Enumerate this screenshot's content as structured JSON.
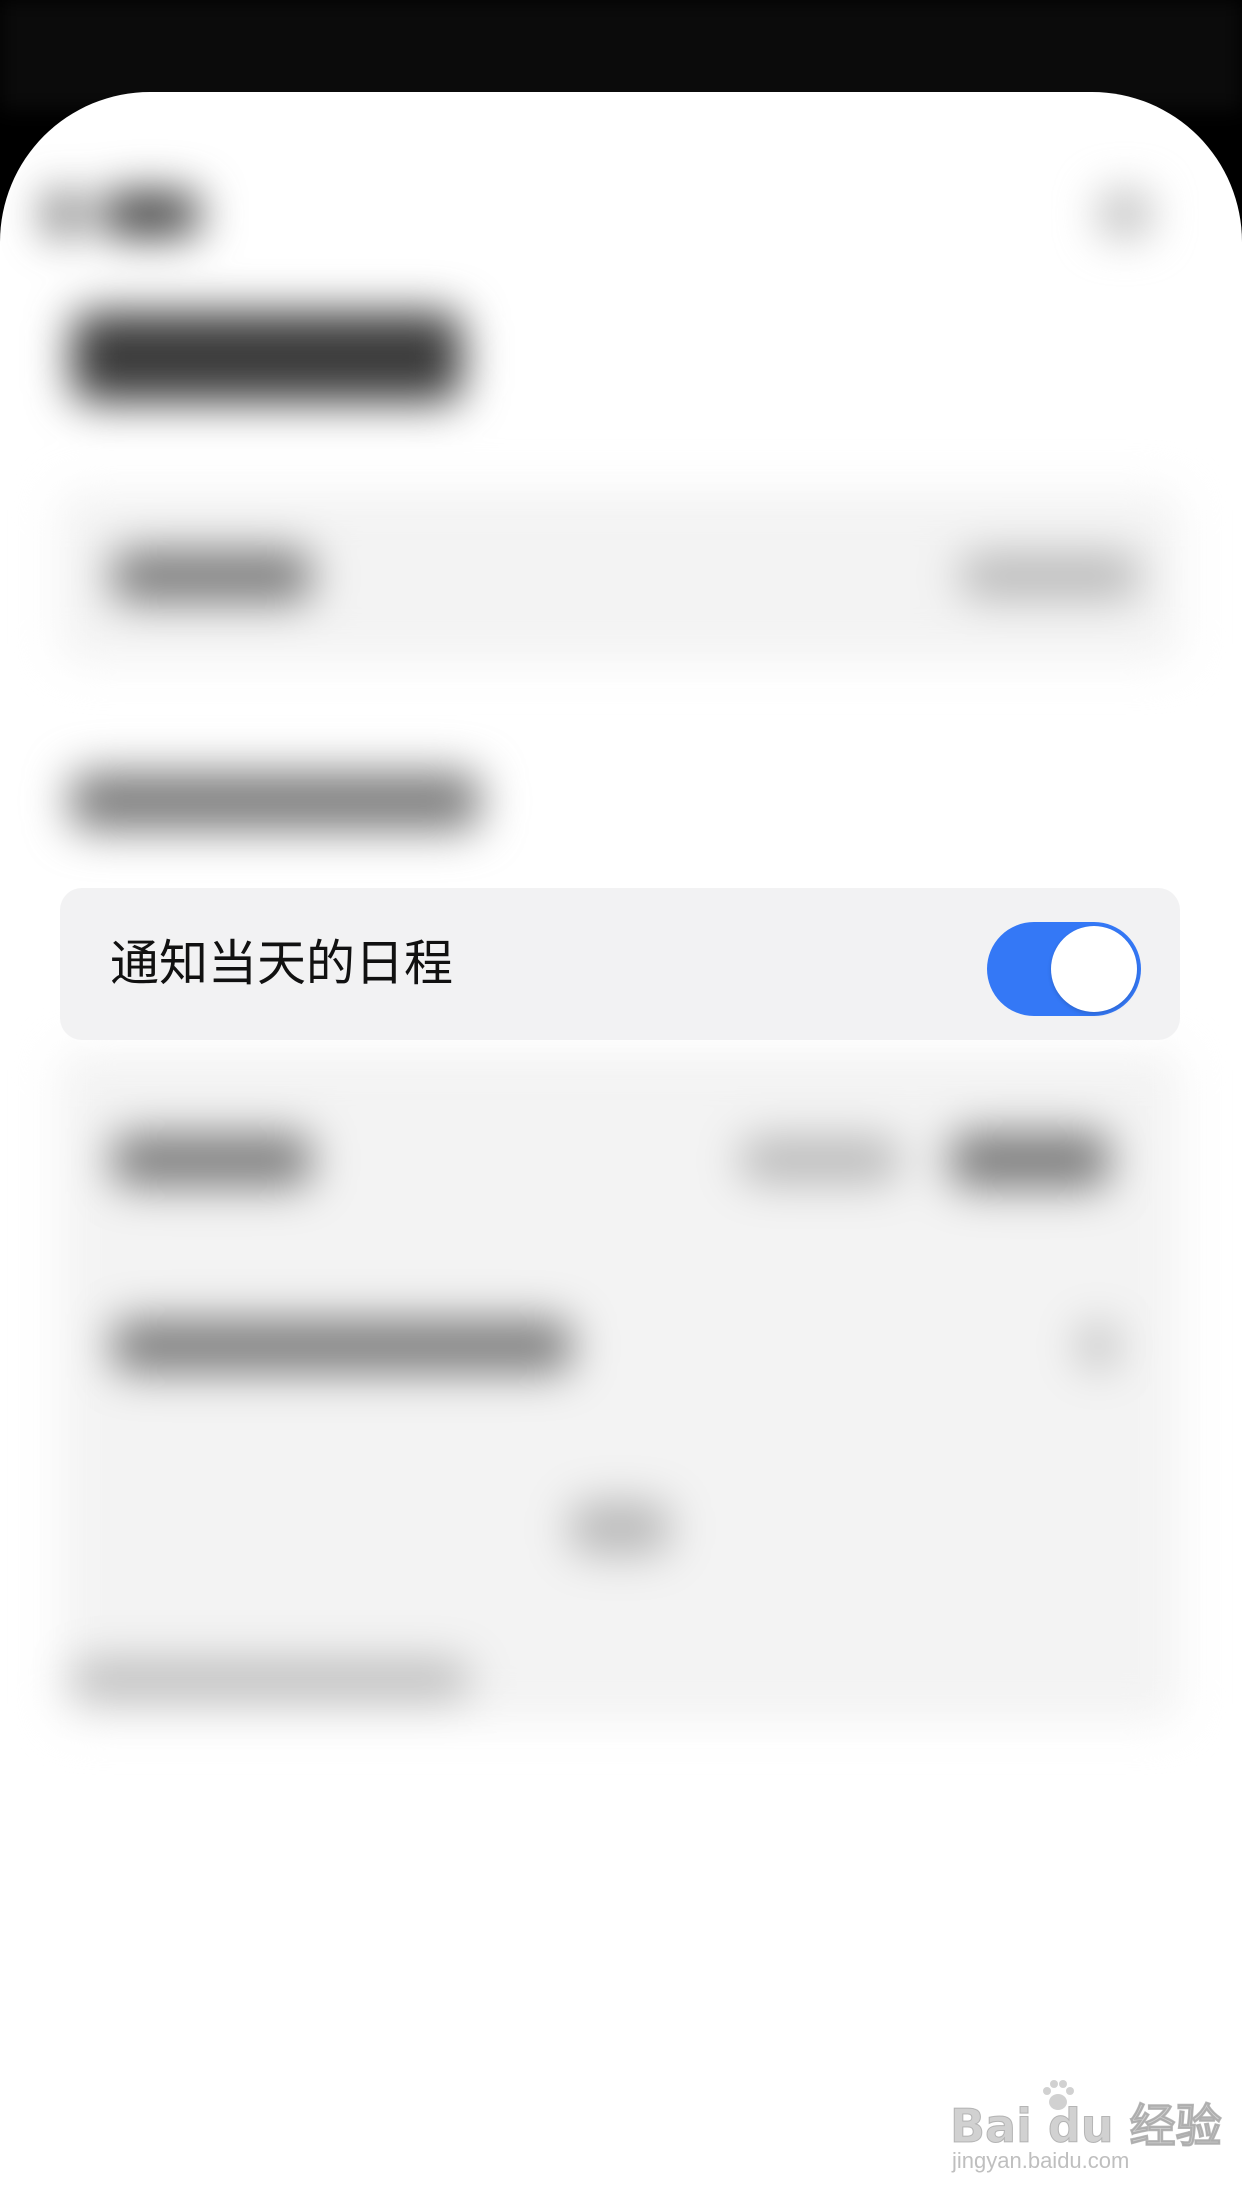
{
  "setting_row": {
    "label": "通知当天的日程",
    "toggle_on": true,
    "toggle_color": "#3478f6"
  },
  "watermark": {
    "brand": "Bai du 经验",
    "url": "jingyan.baidu.com"
  },
  "colors": {
    "sheet_background": "#ffffff",
    "card_background": "#f2f2f3",
    "text_primary": "#111111"
  }
}
